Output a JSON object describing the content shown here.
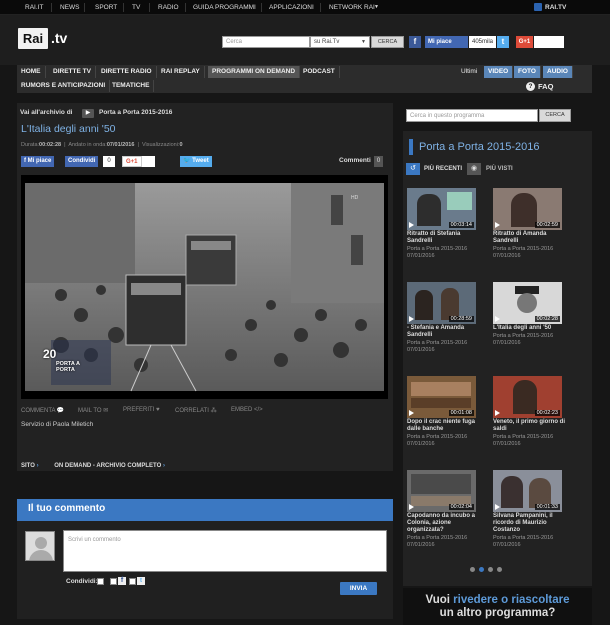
{
  "topbar": {
    "items": [
      "RAI.IT",
      "NEWS",
      "SPORT",
      "TV",
      "RADIO",
      "GUIDA PROGRAMMI",
      "APPLICAZIONI",
      "NETWORK RAI"
    ],
    "right_label": "RAI.TV"
  },
  "header": {
    "logo_text": "Rai",
    "logo_suffix": ".tv",
    "search_placeholder": "Cerca",
    "search_scope": "su Rai.Tv",
    "search_button": "CERCA",
    "like_label": "Mi piace",
    "like_count": "405mila",
    "gplus_label": "G+1"
  },
  "nav": {
    "items": [
      "HOME",
      "DIRETTE TV",
      "DIRETTE RADIO",
      "RAI REPLAY",
      "PROGRAMMI ON DEMAND",
      "PODCAST"
    ],
    "items_row2": [
      "RUMORS E ANTICIPAZIONI",
      "TEMATICHE"
    ],
    "right_items": [
      "Ultimi",
      "VIDEO",
      "FOTO",
      "AUDIO"
    ],
    "faq": "FAQ"
  },
  "main": {
    "breadcrumb_label": "Vai all'archivio di",
    "breadcrumb_link": "Porta a Porta 2015-2016",
    "title": "L'Italia degli anni '50",
    "meta": {
      "duration_label": "Durata:",
      "duration": "00:02:28",
      "aired_label": "Andato in onda:",
      "aired": "07/01/2016",
      "views_label": "Visualizzazioni:",
      "views": "0"
    },
    "share": {
      "like": "Mi piace",
      "share": "Condividi",
      "share_count": "0",
      "gplus": "G+1",
      "tweet": "Tweet"
    },
    "comments_label": "Commenti",
    "comments_count": "0",
    "video_overlay_number": "20",
    "video_overlay_text": "PORTA A PORTA",
    "video_watermark": "HD",
    "toolbar": [
      "COMMENTA",
      "MAIL TO",
      "PREFERITI",
      "CORRELATI",
      "EMBED"
    ],
    "author": "Servizio di Paola Miletich",
    "footer_links": [
      "SITO",
      "ON DEMAND - ARCHIVIO COMPLETO"
    ]
  },
  "comment_box": {
    "title": "Il tuo commento",
    "placeholder": "Scrivi un commento",
    "share_label": "Condividi:",
    "send": "INVIA"
  },
  "sidebar": {
    "search_placeholder": "Cerca in questo programma",
    "search_button": "CERCA",
    "title": "Porta a Porta 2015-2016",
    "tabs": [
      "PIÙ RECENTI",
      "PIÙ VISTI"
    ],
    "clips": [
      {
        "title": "Ritratto di Stefania Sandrelli",
        "program": "Porta a Porta 2015-2016",
        "date": "07/01/2016",
        "duration": "00:03:14"
      },
      {
        "title": "Ritratto di Amanda Sandrelli",
        "program": "Porta a Porta 2015-2016",
        "date": "07/01/2016",
        "duration": "00:02:59"
      },
      {
        "title": "- Stefania e Amanda Sandrelli",
        "program": "Porta a Porta 2015-2016",
        "date": "07/01/2016",
        "duration": "00:28:59"
      },
      {
        "title": "L'Italia degli anni '50",
        "program": "Porta a Porta 2015-2016",
        "date": "07/01/2016",
        "duration": "00:02:28"
      },
      {
        "title": "Dopo il crac niente fuga dalle banche",
        "program": "Porta a Porta 2015-2016",
        "date": "07/01/2016",
        "duration": "00:01:08"
      },
      {
        "title": "Veneto, il primo giorno di saldi",
        "program": "Porta a Porta 2015-2016",
        "date": "07/01/2016",
        "duration": "00:02:23"
      },
      {
        "title": "Capodanno da incubo a Colonia, azione organizzata?",
        "program": "Porta a Porta 2015-2016",
        "date": "07/01/2016",
        "duration": "00:02:04"
      },
      {
        "title": "Silvana Pampanini, il ricordo di Maurizio Costanzo",
        "program": "Porta a Porta 2015-2016",
        "date": "07/01/2016",
        "duration": "00:01:33"
      }
    ],
    "promo_line1_a": "Vuoi ",
    "promo_line1_b": "rivedere o riascoltare",
    "promo_line2": "un altro programma?"
  }
}
